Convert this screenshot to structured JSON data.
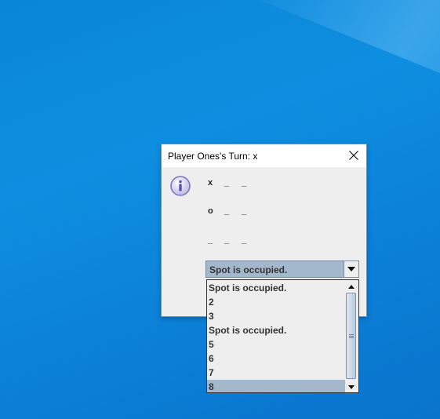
{
  "window": {
    "title": "Player Ones's Turn: x"
  },
  "board": {
    "rows": [
      [
        "x",
        "_",
        "_"
      ],
      [
        "o",
        "_",
        "_"
      ],
      [
        "_",
        "_",
        "_"
      ]
    ]
  },
  "combo": {
    "selected": "Spot is occupied."
  },
  "dropdown": {
    "items": [
      "Spot is occupied.",
      "2",
      "3",
      "Spot is occupied.",
      "5",
      "6",
      "7",
      "8"
    ],
    "selected_index": 7
  },
  "icons": {
    "dialog": "info-icon",
    "close": "close-icon"
  },
  "colors": {
    "selection": "#a3b8cc",
    "desktop": "#0a86d8"
  }
}
